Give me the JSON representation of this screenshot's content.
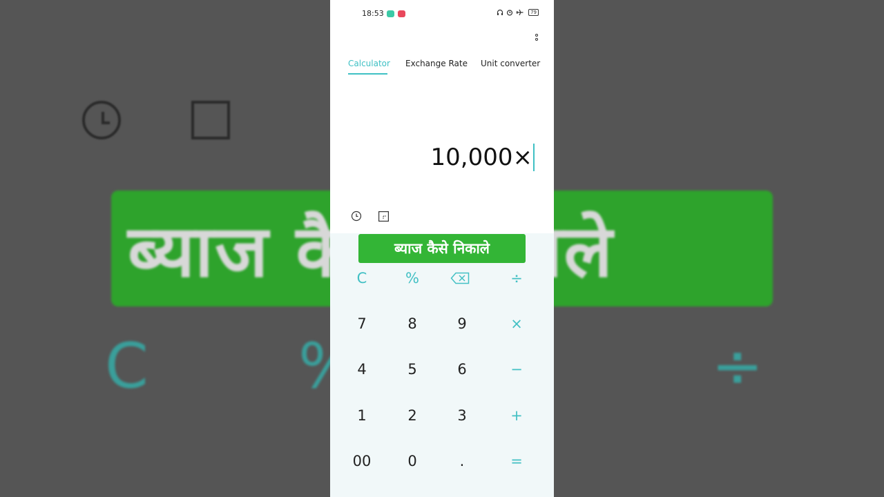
{
  "background": {
    "banner_text": "ब्याज कैसे निकाले",
    "key_c": "C",
    "key_percent": "%",
    "key_divide": "÷"
  },
  "status_bar": {
    "time": "18:53",
    "battery": "79"
  },
  "tabs": [
    {
      "label": "Calculator",
      "active": true
    },
    {
      "label": "Exchange Rate",
      "active": false
    },
    {
      "label": "Unit converter",
      "active": false
    }
  ],
  "display": {
    "expression": "10,000×"
  },
  "keypad": {
    "row1": [
      "C",
      "%",
      "⌫",
      "÷"
    ],
    "row2": [
      "7",
      "8",
      "9",
      "×"
    ],
    "row3": [
      "4",
      "5",
      "6",
      "−"
    ],
    "row4": [
      "1",
      "2",
      "3",
      "+"
    ],
    "row5": [
      "00",
      "0",
      ".",
      "="
    ]
  },
  "overlay": {
    "title": "ब्याज कैसे निकाले"
  },
  "colors": {
    "accent": "#3ec0c4",
    "banner_green": "#33b536",
    "keypad_bg": "#f1f8f9"
  }
}
